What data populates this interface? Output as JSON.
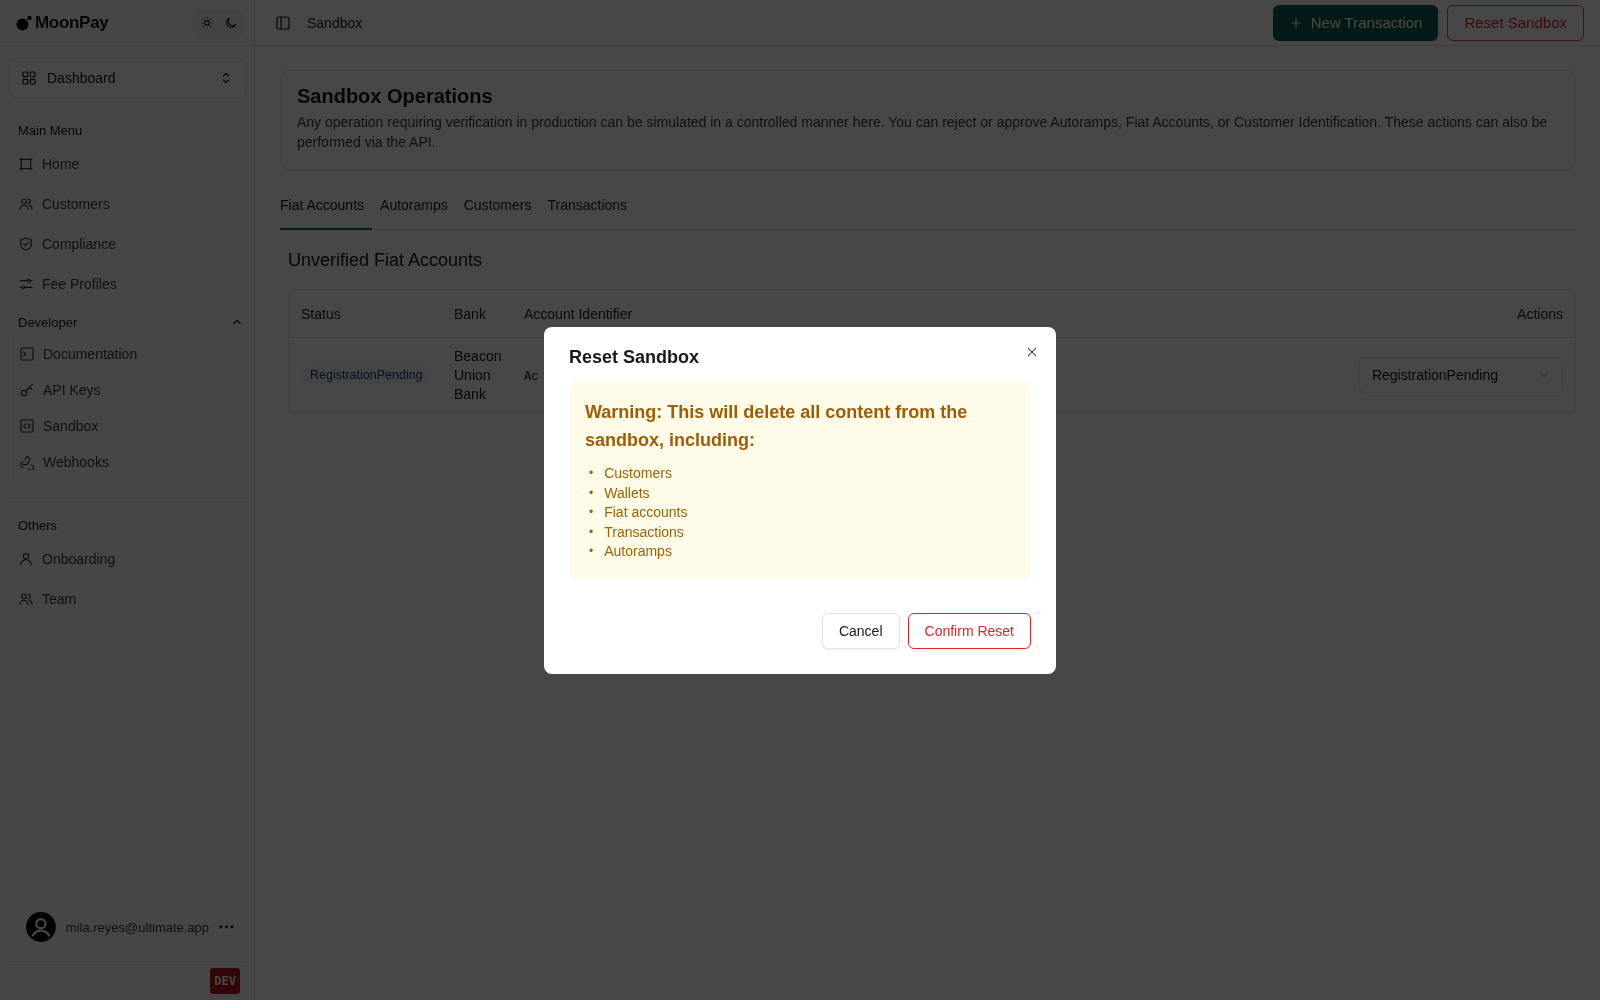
{
  "sidebar": {
    "logo": "MoonPay",
    "workspace": "Dashboard",
    "sections": [
      {
        "label": "Main Menu",
        "items": [
          {
            "label": "Home"
          },
          {
            "label": "Customers"
          },
          {
            "label": "Compliance"
          },
          {
            "label": "Fee Profiles"
          }
        ]
      },
      {
        "label": "Developer",
        "expanded": true,
        "items": [
          {
            "label": "Documentation"
          },
          {
            "label": "API Keys"
          },
          {
            "label": "Sandbox"
          },
          {
            "label": "Webhooks"
          }
        ]
      },
      {
        "label": "Others",
        "items": [
          {
            "label": "Onboarding"
          },
          {
            "label": "Team"
          }
        ]
      }
    ],
    "user": {
      "email": "mila.reyes@ultimate.app"
    },
    "env_badge": "DEV"
  },
  "header": {
    "breadcrumb": "Sandbox",
    "buttons": [
      {
        "label": "New Transaction",
        "kind": "primary"
      },
      {
        "label": "Reset Sandbox",
        "kind": "danger"
      }
    ]
  },
  "intro": {
    "title": "Sandbox Operations",
    "text": "Any operation requiring verification in production can be simulated in a controlled manner here. You can reject or approve Autoramps, Fiat Accounts, or Customer Identification. These actions can also be performed via the API."
  },
  "tabs": [
    {
      "label": "Fiat Accounts",
      "selected": true
    },
    {
      "label": "Autoramps",
      "selected": false
    },
    {
      "label": "Customers",
      "selected": false
    },
    {
      "label": "Transactions",
      "selected": false
    }
  ],
  "table": {
    "title": "Unverified Fiat Accounts",
    "columns": [
      "Status",
      "Bank",
      "Account Identifier",
      "Actions"
    ],
    "rows": [
      {
        "status": "RegistrationPending",
        "bank": "Beacon Union Bank",
        "account": "Ac",
        "action": "RegistrationPending"
      }
    ]
  },
  "dialog": {
    "title": "Reset Sandbox",
    "warning": "Warning: This will delete all content from the sandbox, including:",
    "items": [
      {
        "bullet": "•",
        "label": "Customers"
      },
      {
        "bullet": "•",
        "label": "Wallets"
      },
      {
        "bullet": "•",
        "label": "Fiat accounts"
      },
      {
        "bullet": "•",
        "label": "Transactions"
      },
      {
        "bullet": "•",
        "label": "Autoramps"
      }
    ],
    "buttons": [
      {
        "label": "Cancel",
        "kind": "secondary"
      },
      {
        "label": "Confirm Reset",
        "kind": "danger"
      }
    ]
  }
}
